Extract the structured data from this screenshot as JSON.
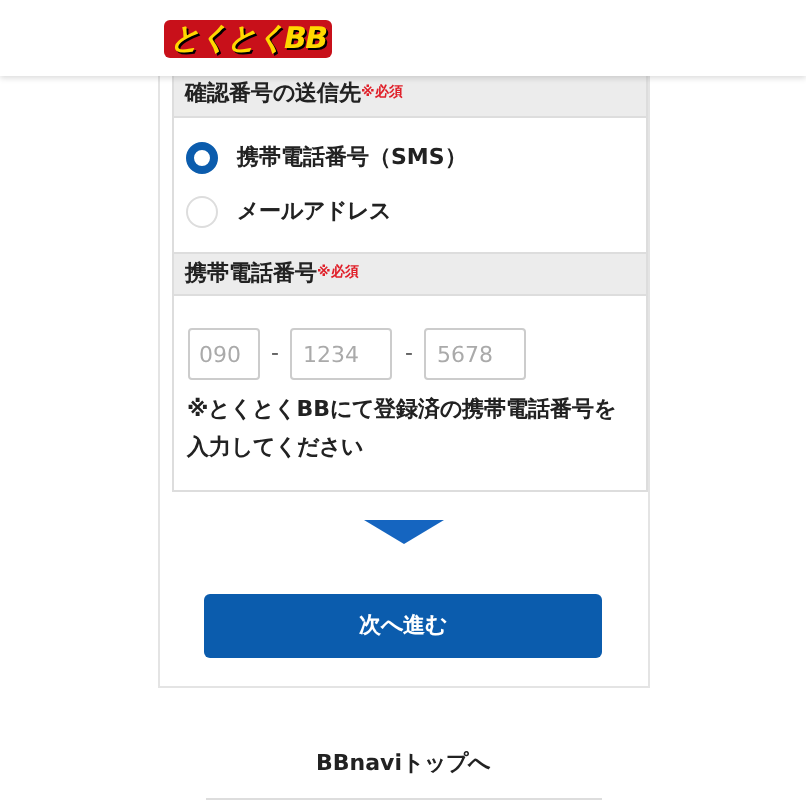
{
  "header": {
    "logo": "とくとくBB"
  },
  "destination": {
    "title": "確認番号の送信先",
    "required": "※必須",
    "options": [
      {
        "label": "携帯電話番号（SMS）",
        "selected": true
      },
      {
        "label": "メールアドレス",
        "selected": false
      }
    ]
  },
  "phone": {
    "title": "携帯電話番号",
    "required": "※必須",
    "fields": [
      {
        "placeholder": "090"
      },
      {
        "placeholder": "1234"
      },
      {
        "placeholder": "5678"
      }
    ],
    "separator": "-",
    "note": "※とくとくBBにて登録済の携帯電話番号を入力してください"
  },
  "next_button": "次へ進む",
  "top_link": "BBnaviトップへ"
}
